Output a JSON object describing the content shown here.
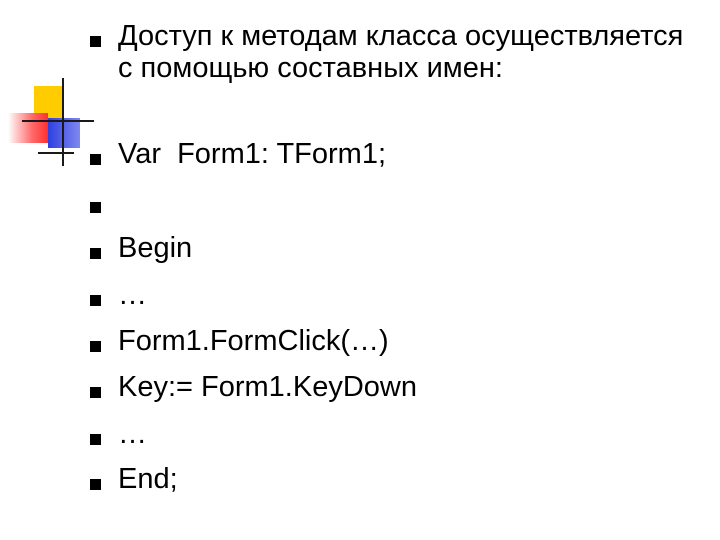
{
  "slide": {
    "items": [
      {
        "text": "Доступ к методам класса осуществляется с помощью составных имен:"
      },
      {
        "text": "Var  Form1: TForm1;"
      },
      {
        "text": ""
      },
      {
        "text": "Begin"
      },
      {
        "text": "…"
      },
      {
        "text": "Form1.FormClick(…)"
      },
      {
        "text": "Key:= Form1.KeyDown"
      },
      {
        "text": "…"
      },
      {
        "text": "End;"
      }
    ]
  },
  "colors": {
    "bullet": "#000000",
    "logo_yellow": "#ffcc00",
    "logo_red": "#ff3030",
    "logo_blue": "#2f3fe0"
  }
}
